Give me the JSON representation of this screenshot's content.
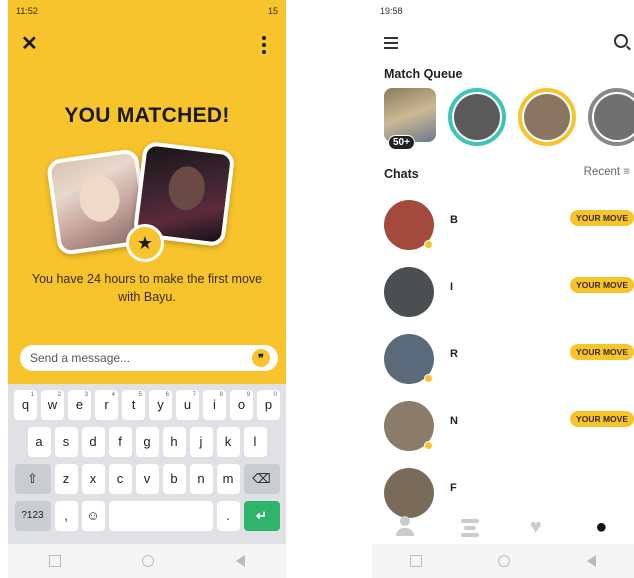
{
  "left": {
    "status_time": "11:52",
    "status_battery": "15",
    "title": "YOU MATCHED!",
    "subtitle": "You have 24 hours to make the first move with Bayu.",
    "message_placeholder": "Send a message...",
    "keyboard": {
      "row1": [
        "q",
        "w",
        "e",
        "r",
        "t",
        "y",
        "u",
        "i",
        "o",
        "p"
      ],
      "row1_nums": [
        "1",
        "2",
        "3",
        "4",
        "5",
        "6",
        "7",
        "8",
        "9",
        "0"
      ],
      "row2": [
        "a",
        "s",
        "d",
        "f",
        "g",
        "h",
        "j",
        "k",
        "l"
      ],
      "row3": [
        "z",
        "x",
        "c",
        "v",
        "b",
        "n",
        "m"
      ],
      "mode_key": "?123",
      "comma_key": ",",
      "period_key": "."
    }
  },
  "right": {
    "status_time": "19:58",
    "match_queue_label": "Match Queue",
    "queue_count": "50+",
    "chats_label": "Chats",
    "sort_label": "Recent",
    "chats": [
      {
        "name": "B",
        "badge": "YOUR MOVE",
        "avatar_color": "#a44a3c"
      },
      {
        "name": "I",
        "badge": "YOUR MOVE",
        "avatar_color": "#4a4f52"
      },
      {
        "name": "R",
        "badge": "YOUR MOVE",
        "avatar_color": "#5a6a7a"
      },
      {
        "name": "N",
        "badge": "YOUR MOVE",
        "avatar_color": "#8a7b6a"
      },
      {
        "name": "F",
        "badge": "",
        "avatar_color": "#7a6a5a"
      }
    ]
  },
  "colors": {
    "accent": "#f8c42d",
    "teal": "#3ec6b5",
    "green": "#2db36b"
  }
}
